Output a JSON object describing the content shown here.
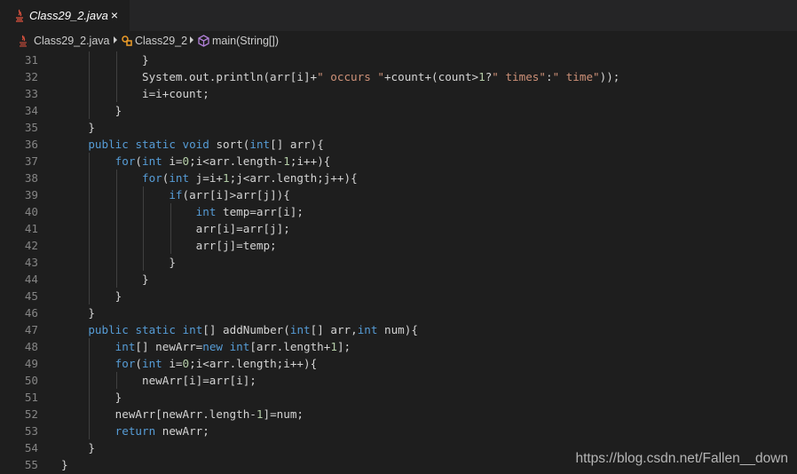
{
  "tab": {
    "title": "Class29_2.java",
    "close_glyph": "×",
    "icon": "java-icon"
  },
  "breadcrumb": {
    "file": "Class29_2.java",
    "class": "Class29_2",
    "method": "main(String[])"
  },
  "watermark": "https://blog.csdn.net/Fallen__down",
  "colors": {
    "background": "#1e1e1e",
    "keyword": "#569cd6",
    "string": "#ce9178",
    "number": "#b5cea8",
    "text": "#d4d4d4",
    "line_number": "#858585"
  },
  "lines": [
    {
      "num": "31",
      "code": "            }"
    },
    {
      "num": "32",
      "code": "            System.out.println(arr[i]+\" occurs \"+count+(count>1?\" times\":\" time\"));"
    },
    {
      "num": "33",
      "code": "            i=i+count;"
    },
    {
      "num": "34",
      "code": "        }"
    },
    {
      "num": "35",
      "code": "    }"
    },
    {
      "num": "36",
      "code": "    public static void sort(int[] arr){"
    },
    {
      "num": "37",
      "code": "        for(int i=0;i<arr.length-1;i++){"
    },
    {
      "num": "38",
      "code": "            for(int j=i+1;j<arr.length;j++){"
    },
    {
      "num": "39",
      "code": "                if(arr[i]>arr[j]){"
    },
    {
      "num": "40",
      "code": "                    int temp=arr[i];"
    },
    {
      "num": "41",
      "code": "                    arr[i]=arr[j];"
    },
    {
      "num": "42",
      "code": "                    arr[j]=temp;"
    },
    {
      "num": "43",
      "code": "                }"
    },
    {
      "num": "44",
      "code": "            }"
    },
    {
      "num": "45",
      "code": "        }"
    },
    {
      "num": "46",
      "code": "    }"
    },
    {
      "num": "47",
      "code": "    public static int[] addNumber(int[] arr,int num){"
    },
    {
      "num": "48",
      "code": "        int[] newArr=new int[arr.length+1];"
    },
    {
      "num": "49",
      "code": "        for(int i=0;i<arr.length;i++){"
    },
    {
      "num": "50",
      "code": "            newArr[i]=arr[i];"
    },
    {
      "num": "51",
      "code": "        }"
    },
    {
      "num": "52",
      "code": "        newArr[newArr.length-1]=num;"
    },
    {
      "num": "53",
      "code": "        return newArr;"
    },
    {
      "num": "54",
      "code": "    }"
    },
    {
      "num": "55",
      "code": "}"
    }
  ]
}
